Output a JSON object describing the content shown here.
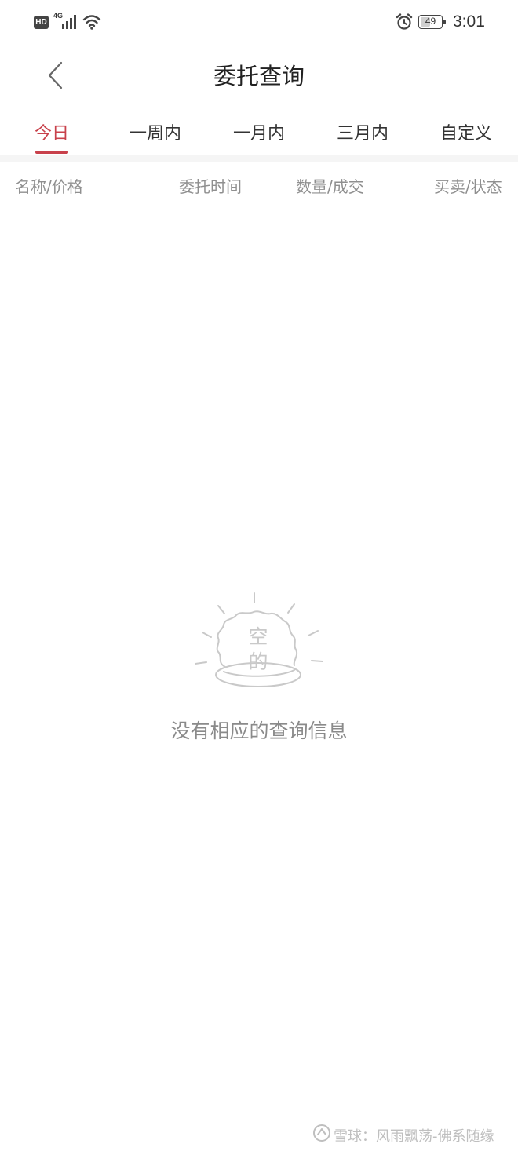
{
  "status_bar": {
    "hd_label": "HD",
    "network_label": "4G",
    "battery_level": "49",
    "battery_fraction": 0.49,
    "time": "3:01",
    "icons": [
      "signal-icon",
      "wifi-icon",
      "alarm-icon",
      "battery-icon"
    ]
  },
  "header": {
    "title": "委托查询",
    "back_icon": "chevron-left-icon"
  },
  "tabs": [
    {
      "label": "今日",
      "active": true
    },
    {
      "label": "一周内",
      "active": false
    },
    {
      "label": "一月内",
      "active": false
    },
    {
      "label": "三月内",
      "active": false
    },
    {
      "label": "自定义",
      "active": false
    }
  ],
  "table_headers": [
    "名称/价格",
    "委托时间",
    "数量/成交",
    "买卖/状态"
  ],
  "empty_state": {
    "icon_label_line1": "空",
    "icon_label_line2": "的",
    "message": "没有相应的查询信息"
  },
  "watermark": {
    "text": "雪球：风雨飘荡-佛系随缘"
  },
  "colors": {
    "accent": "#c8414b",
    "muted_text": "#8f8f8f",
    "empty_text": "#8a8a8a",
    "divider": "#f5f5f5"
  }
}
